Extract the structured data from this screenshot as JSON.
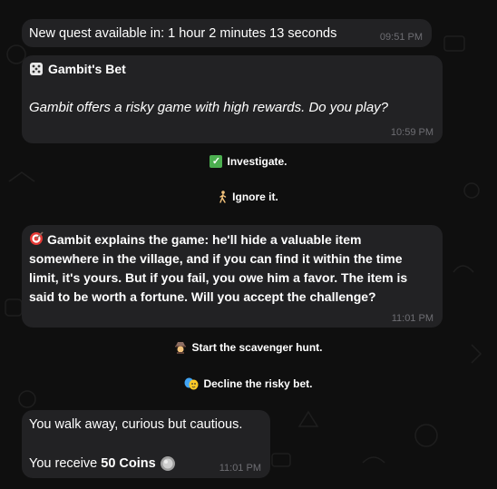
{
  "messages": {
    "quest_timer": {
      "text": "New quest available in: 1 hour 2 minutes 13 seconds",
      "time": "09:51 PM"
    },
    "gambit_bet": {
      "title": "Gambit's Bet",
      "body": "Gambit offers a risky game with high rewards. Do you play?",
      "time": "10:59 PM"
    },
    "gambit_explains": {
      "body": "Gambit explains the game: he'll hide a valuable item somewhere in the village, and if you can find it within the time limit, it's yours. But if you fail, you owe him a favor. The item is said to be worth a fortune. Will you accept the challenge?",
      "time": "11:01 PM"
    },
    "walk_away": {
      "line1": "You walk away, curious but cautious.",
      "receive_prefix": "You receive",
      "reward": "50 Coins",
      "time": "11:01 PM"
    }
  },
  "buttons": {
    "investigate": {
      "label": "Investigate.",
      "icon": "check-mark-icon"
    },
    "ignore": {
      "label": "Ignore it.",
      "icon": "walking-person-icon"
    },
    "scavenger": {
      "label": "Start the scavenger hunt.",
      "icon": "detective-icon"
    },
    "decline": {
      "label": "Decline the risky bet.",
      "icon": "masks-icon"
    }
  },
  "colors": {
    "background": "#0f0f0f",
    "bubble": "#222224",
    "timestamp": "#6e6e73",
    "check_green": "#4caf50"
  }
}
